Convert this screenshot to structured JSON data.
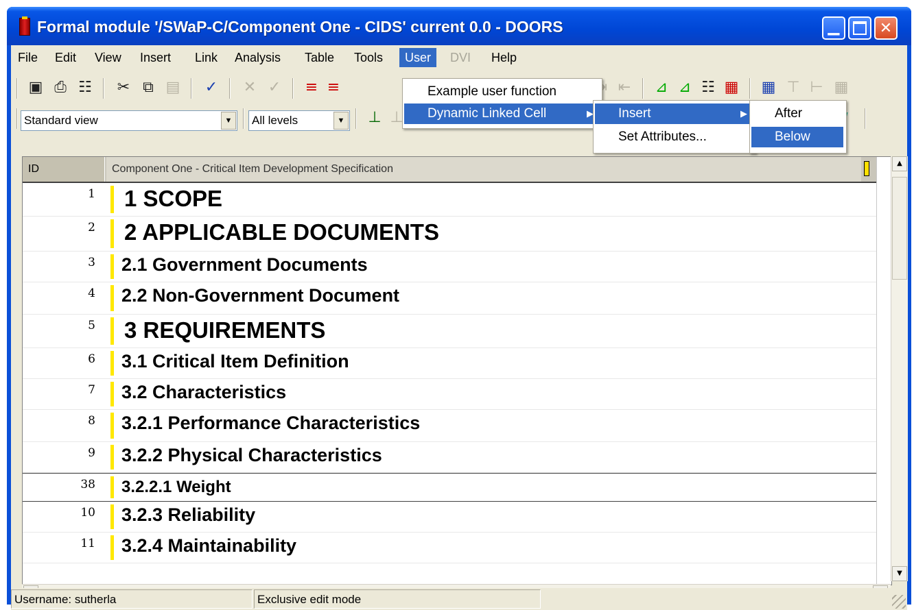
{
  "window": {
    "title": "Formal module '/SWaP-C/Component One - CIDS' current 0.0 - DOORS"
  },
  "menubar": {
    "items": [
      {
        "label": "File"
      },
      {
        "label": "Edit"
      },
      {
        "label": "View"
      },
      {
        "label": "Insert"
      },
      {
        "label": "Link"
      },
      {
        "label": "Analysis"
      },
      {
        "label": "Table"
      },
      {
        "label": "Tools"
      },
      {
        "label": "User"
      },
      {
        "label": "DVI"
      },
      {
        "label": "Help"
      }
    ]
  },
  "toolbar2": {
    "view_select": "Standard view",
    "level_select": "All levels"
  },
  "grid": {
    "header_id": "ID",
    "header_main": "Component One - Critical Item Development Specification",
    "rows": [
      {
        "id": "1",
        "text": "1 SCOPE"
      },
      {
        "id": "2",
        "text": "2 APPLICABLE DOCUMENTS"
      },
      {
        "id": "3",
        "text": "2.1 Government Documents"
      },
      {
        "id": "4",
        "text": "2.2 Non-Government Document"
      },
      {
        "id": "5",
        "text": "3 REQUIREMENTS"
      },
      {
        "id": "6",
        "text": "3.1 Critical Item Definition"
      },
      {
        "id": "7",
        "text": "3.2 Characteristics"
      },
      {
        "id": "8",
        "text": "3.2.1 Performance Characteristics"
      },
      {
        "id": "9",
        "text": "3.2.2 Physical Characteristics"
      },
      {
        "id": "38",
        "text": "3.2.2.1 Weight"
      },
      {
        "id": "10",
        "text": "3.2.3 Reliability"
      },
      {
        "id": "11",
        "text": "3.2.4 Maintainability"
      }
    ]
  },
  "user_menu": {
    "items": [
      {
        "label": "Example user function"
      },
      {
        "label": "Dynamic Linked Cell"
      }
    ]
  },
  "dlc_menu": {
    "items": [
      {
        "label": "Insert"
      },
      {
        "label": "Set Attributes..."
      }
    ]
  },
  "insert_menu": {
    "items": [
      {
        "label": "After"
      },
      {
        "label": "Below"
      }
    ]
  },
  "statusbar": {
    "username": "Username: sutherla",
    "mode": "Exclusive edit mode"
  }
}
